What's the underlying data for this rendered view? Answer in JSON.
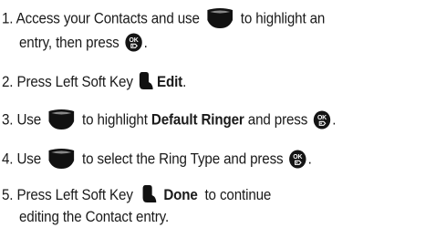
{
  "steps": [
    {
      "number": "1.",
      "line1_a": "Access your Contacts and use",
      "line1_b": "to highlight an",
      "line2_a": "entry, then press",
      "line2_end": "."
    },
    {
      "number": "2.",
      "text_a": "Press Left Soft Key",
      "bold": "Edit",
      "end": "."
    },
    {
      "number": "3.",
      "text_a": "Use",
      "text_b": "to highlight",
      "bold": "Default Ringer",
      "text_c": "and press",
      "end": "."
    },
    {
      "number": "4.",
      "text_a": "Use",
      "text_b": "to select the Ring Type and press",
      "end": "."
    },
    {
      "number": "5.",
      "text_a": "Press Left Soft Key",
      "bold": "Done",
      "text_b": "to continue",
      "line2": "editing the Contact entry."
    }
  ],
  "icons": {
    "nav": "navigation-key-icon",
    "ok": "ok-key-icon",
    "ok_label": "OK",
    "left_soft_key": "left-soft-key-icon"
  }
}
